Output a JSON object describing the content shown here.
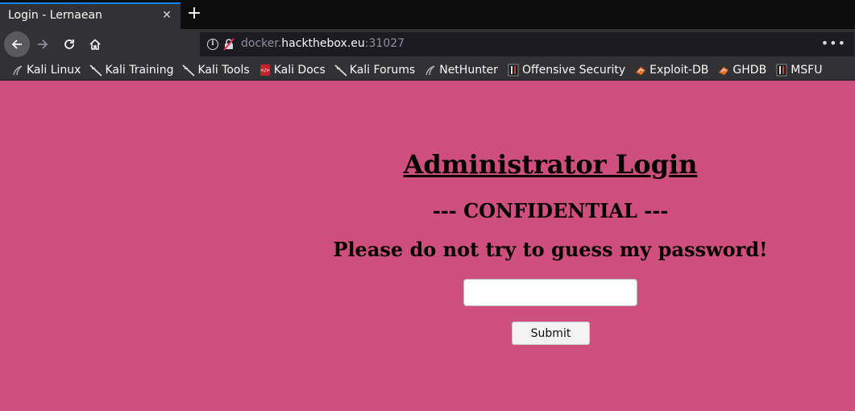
{
  "tab": {
    "title": "Login - Lernaean",
    "close_icon": "close-icon",
    "new_tab_icon": "plus-icon"
  },
  "nav": {
    "back_icon": "back-arrow-icon",
    "forward_icon": "forward-arrow-icon",
    "reload_icon": "reload-icon",
    "home_icon": "home-icon"
  },
  "url": {
    "prefix": "docker.",
    "host": "hackthebox.eu",
    "port": ":31027",
    "info_icon": "i",
    "menu_icon": "•••"
  },
  "bookmarks": [
    {
      "label": "Kali Linux",
      "icon": "kali-dragon-icon"
    },
    {
      "label": "Kali Training",
      "icon": "kali-dragon-icon"
    },
    {
      "label": "Kali Tools",
      "icon": "kali-dragon-icon"
    },
    {
      "label": "Kali Docs",
      "icon": "kali-docs-icon"
    },
    {
      "label": "Kali Forums",
      "icon": "kali-dragon-icon"
    },
    {
      "label": "NetHunter",
      "icon": "nethunter-icon"
    },
    {
      "label": "Offensive Security",
      "icon": "offsec-icon"
    },
    {
      "label": "Exploit-DB",
      "icon": "exploitdb-icon"
    },
    {
      "label": "GHDB",
      "icon": "exploitdb-icon"
    },
    {
      "label": "MSFU",
      "icon": "offsec-icon"
    }
  ],
  "page": {
    "title": "Administrator Login",
    "subtitle": "--- CONFIDENTIAL ---",
    "warning": "Please do not try to guess my password!",
    "password_value": "",
    "submit_label": "Submit",
    "background_color": "#ce4f7b"
  }
}
